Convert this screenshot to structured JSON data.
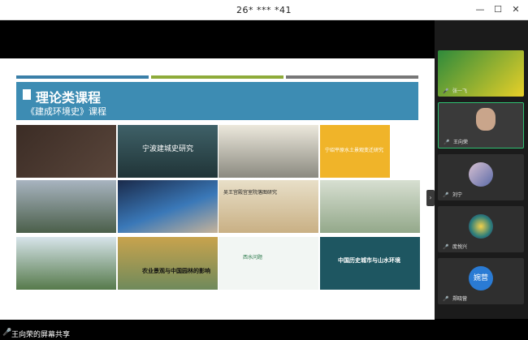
{
  "window": {
    "title": "26* *** *41"
  },
  "slide": {
    "title": "理论类课程",
    "subtitle": "《建成环境史》课程",
    "thumbnails": [
      {
        "caption": ""
      },
      {
        "caption": "宁波建城史研究"
      },
      {
        "caption": ""
      },
      {
        "caption": "宁绍平原水土景观变迁研究"
      },
      {
        "caption": ""
      },
      {
        "caption": ""
      },
      {
        "caption": "吴王宫殿宫室院落图研究"
      },
      {
        "caption": ""
      },
      {
        "caption": ""
      },
      {
        "caption": "农业景观与中国园林的影响"
      },
      {
        "caption": "西水问题"
      },
      {
        "caption": "中国历史城市与山水环境"
      }
    ]
  },
  "participants": [
    {
      "name": "张一飞"
    },
    {
      "name": "王向荣"
    },
    {
      "name": "刘宁"
    },
    {
      "name": "庞悦兴"
    },
    {
      "name": "郑晓营",
      "avatar_text": "婉营"
    }
  ],
  "status": {
    "share_label": "王向荣的屏幕共享"
  },
  "colors": {
    "accent_blue": "#3d8cb3",
    "accent_green": "#8eab3a"
  }
}
